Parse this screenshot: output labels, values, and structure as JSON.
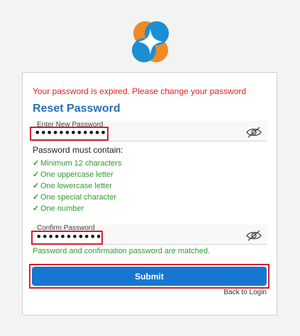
{
  "error_message": "Your password is expired. Please change your password",
  "title": "Reset Password",
  "new_password": {
    "label": "Enter New Password",
    "value": "••••••••••••••"
  },
  "rules": {
    "heading": "Password must contain:",
    "check_glyph": "✓",
    "items": [
      "Minimum 12 characters",
      "One uppercase letter",
      "One lowercase letter",
      "One special character",
      "One number"
    ]
  },
  "confirm_password": {
    "label": "Confirm Password",
    "value": "••••••••••••••"
  },
  "match_message": "Password and confirmation password are matched.",
  "submit_label": "Submit",
  "back_link": "Back to Login",
  "icons": {
    "logo": "brand-logo-icon",
    "eye": "eye-slash-icon"
  },
  "colors": {
    "error": "#e0241b",
    "success": "#2e9b2e",
    "title": "#2b6fb3",
    "button": "#1677d2",
    "highlight": "#d3212d",
    "logo_orange": "#f08a24",
    "logo_blue": "#1a8fd6"
  }
}
